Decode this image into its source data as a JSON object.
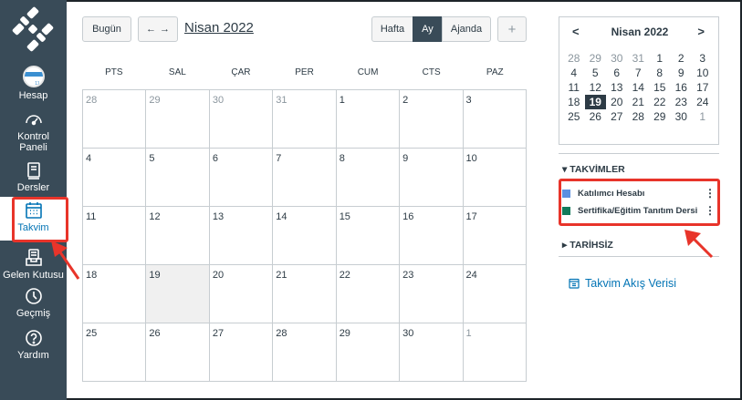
{
  "sidebar": {
    "items": [
      {
        "label": "Hesap",
        "icon": "avatar-icon"
      },
      {
        "label": "Kontrol Paneli",
        "icon": "dashboard-icon"
      },
      {
        "label": "Dersler",
        "icon": "courses-icon"
      },
      {
        "label": "Takvim",
        "icon": "calendar-icon"
      },
      {
        "label": "Gelen Kutusu",
        "icon": "inbox-icon"
      },
      {
        "label": "Geçmiş",
        "icon": "clock-icon"
      },
      {
        "label": "Yardım",
        "icon": "help-icon"
      }
    ],
    "kontrol_line1": "Kontrol",
    "kontrol_line2": "Paneli"
  },
  "toolbar": {
    "today_label": "Bugün",
    "prev_arrow": "←",
    "next_arrow": "→",
    "month_title": "Nisan 2022",
    "view_week": "Hafta",
    "view_month": "Ay",
    "view_agenda": "Ajanda",
    "add_label": "+"
  },
  "calendar": {
    "days_of_week": [
      "PTS",
      "SAL",
      "ÇAR",
      "PER",
      "CUM",
      "CTS",
      "PAZ"
    ],
    "weeks": [
      [
        "28",
        "29",
        "30",
        "31",
        "1",
        "2",
        "3"
      ],
      [
        "4",
        "5",
        "6",
        "7",
        "8",
        "9",
        "10"
      ],
      [
        "11",
        "12",
        "13",
        "14",
        "15",
        "16",
        "17"
      ],
      [
        "18",
        "19",
        "20",
        "21",
        "22",
        "23",
        "24"
      ],
      [
        "25",
        "26",
        "27",
        "28",
        "29",
        "30",
        "1"
      ]
    ]
  },
  "mini_calendar": {
    "title": "Nisan 2022",
    "prev": "<",
    "next": ">",
    "weeks": [
      [
        "28",
        "29",
        "30",
        "31",
        "1",
        "2",
        "3"
      ],
      [
        "4",
        "5",
        "6",
        "7",
        "8",
        "9",
        "10"
      ],
      [
        "11",
        "12",
        "13",
        "14",
        "15",
        "16",
        "17"
      ],
      [
        "18",
        "19",
        "20",
        "21",
        "22",
        "23",
        "24"
      ],
      [
        "25",
        "26",
        "27",
        "28",
        "29",
        "30",
        "1"
      ]
    ]
  },
  "calendars_section": {
    "heading": "▾ TAKVİMLER",
    "items": [
      {
        "label": "Katılımcı Hesabı",
        "color": "#5b8fe0"
      },
      {
        "label": "Sertifika/Eğitim Tanıtım Dersi",
        "color": "#127a5a"
      }
    ],
    "kebab": "⋮"
  },
  "undated_section": {
    "heading": "▸ TARİHSİZ"
  },
  "feed": {
    "label": "Takvim Akış Verisi"
  },
  "colors": {
    "sidebar_bg": "#394b58",
    "accent": "#0374b5",
    "highlight": "#e8342a"
  }
}
